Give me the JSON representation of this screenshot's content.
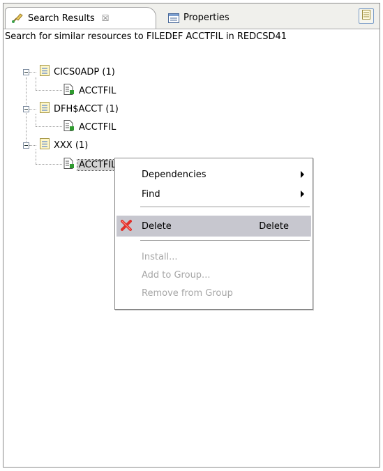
{
  "tabs": [
    {
      "label": "Search Results",
      "close_glyph": "☒",
      "icon": "search-results-icon"
    },
    {
      "label": "Properties",
      "icon": "properties-icon"
    }
  ],
  "view_menu_icon": "view-menu-icon",
  "description": "Search for similar resources to FILEDEF ACCTFIL in REDCSD41",
  "tree": {
    "groups": [
      {
        "label": "CICS0ADP (1)",
        "child": "ACCTFIL"
      },
      {
        "label": "DFH$ACCT (1)",
        "child": "ACCTFIL"
      },
      {
        "label": "XXX (1)",
        "child": "ACCTFIL"
      }
    ]
  },
  "context_menu": {
    "items": [
      {
        "label": "Dependencies",
        "submenu": true,
        "enabled": true
      },
      {
        "label": "Find",
        "submenu": true,
        "enabled": true
      },
      {
        "label": "Delete",
        "accelerator": "Delete",
        "enabled": true,
        "highlighted": true,
        "icon": "delete-x-icon"
      },
      {
        "label": "Install...",
        "enabled": false
      },
      {
        "label": "Add to Group...",
        "enabled": false
      },
      {
        "label": "Remove from Group",
        "enabled": false
      }
    ]
  },
  "colors": {
    "highlight": "#c7c7cf",
    "disabled_text": "#a6a6a6",
    "delete_icon": "#e0302a",
    "file_icon_green": "#2f9a2f"
  }
}
